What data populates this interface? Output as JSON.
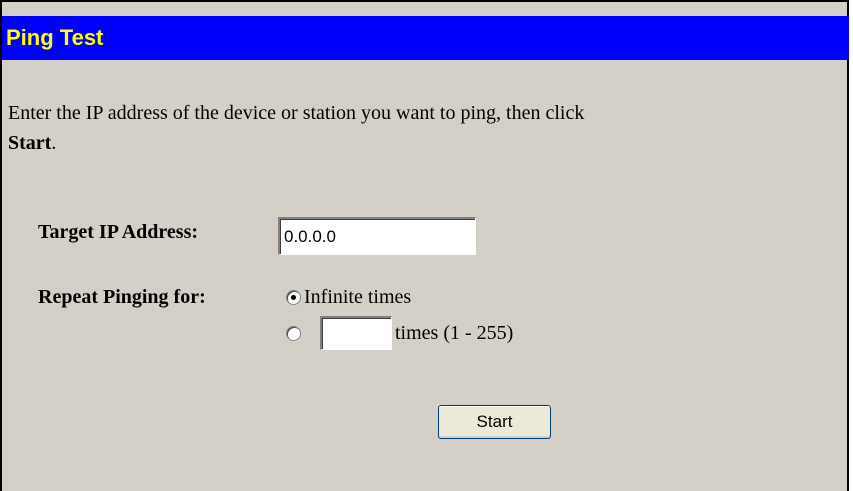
{
  "header": {
    "title": "Ping Test"
  },
  "intro": {
    "text": "Enter the IP address of the device or station you want to ping, then click",
    "emphasis": "Start",
    "suffix": "."
  },
  "form": {
    "target_label": "Target IP Address:",
    "target_value": "0.0.0.0",
    "repeat_label": "Repeat Pinging for:",
    "option_infinite": "Infinite times",
    "option_times": "times (1 - 255)",
    "times_value": "",
    "selected_option": "infinite"
  },
  "actions": {
    "start_label": "Start"
  },
  "colors": {
    "title_bg": "#0000ff",
    "title_text": "#ffff00",
    "panel_bg": "#d4d0c8"
  }
}
